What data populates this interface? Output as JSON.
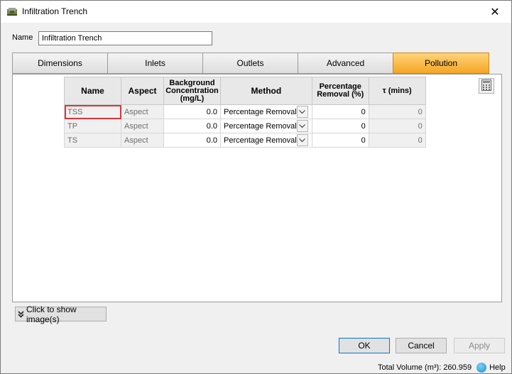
{
  "window": {
    "title": "Infiltration Trench",
    "close_glyph": "✕"
  },
  "name_field": {
    "label": "Name",
    "value": "Infiltration Trench"
  },
  "tabs": [
    {
      "label": "Dimensions",
      "active": false
    },
    {
      "label": "Inlets",
      "active": false
    },
    {
      "label": "Outlets",
      "active": false
    },
    {
      "label": "Advanced",
      "active": false
    },
    {
      "label": "Pollution",
      "active": true
    }
  ],
  "table": {
    "headers": {
      "name": "Name",
      "aspect": "Aspect",
      "background": "Background Concentration (mg/L)",
      "method": "Method",
      "removal": "Percentage Removal (%)",
      "tau": "τ (mins)"
    },
    "rows": [
      {
        "name": "TSS",
        "aspect": "Aspect",
        "background": "0.0",
        "method": "Percentage Removal",
        "removal": "0",
        "tau": "0"
      },
      {
        "name": "TP",
        "aspect": "Aspect",
        "background": "0.0",
        "method": "Percentage Removal",
        "removal": "0",
        "tau": "0"
      },
      {
        "name": "TS",
        "aspect": "Aspect",
        "background": "0.0",
        "method": "Percentage Removal",
        "removal": "0",
        "tau": "0"
      }
    ]
  },
  "show_images_label": "Click to show image(s)",
  "buttons": {
    "ok": "OK",
    "cancel": "Cancel",
    "apply": "Apply"
  },
  "status": {
    "total_volume": "Total Volume (m³): 260.959",
    "help": "Help"
  },
  "colors": {
    "active_tab": "#f5a623",
    "selected_cell_border": "#d9363e"
  },
  "icons": {
    "app": "trench-app-icon",
    "calculator": "calculator-icon",
    "expand": "double-chevron-down-icon",
    "help": "help-icon",
    "dropdown": "chevron-down-icon"
  }
}
